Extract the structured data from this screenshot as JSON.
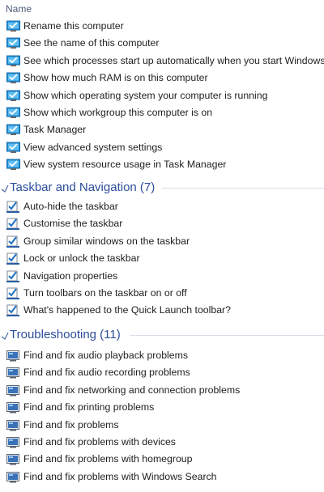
{
  "list": {
    "column_header": "Name"
  },
  "groups": [
    {
      "title": "",
      "icon": "monitor-check-icon",
      "items": [
        "Rename this computer",
        "See the name of this computer",
        "See which processes start up automatically when you start Windows",
        "Show how much RAM is on this computer",
        "Show which operating system your computer is running",
        "Show which workgroup this computer is on",
        "Task Manager",
        "View advanced system settings",
        "View system resource usage in Task Manager"
      ]
    },
    {
      "title": "Taskbar and Navigation (7)",
      "icon": "taskbar-check-icon",
      "items": [
        "Auto-hide the taskbar",
        "Customise the taskbar",
        "Group similar windows on the taskbar",
        "Lock or unlock the taskbar",
        "Navigation properties",
        "Turn toolbars on the taskbar on or off",
        "What's happened to the Quick Launch toolbar?"
      ]
    },
    {
      "title": "Troubleshooting (11)",
      "icon": "troubleshoot-icon",
      "items": [
        "Find and fix audio playback problems",
        "Find and fix audio recording problems",
        "Find and fix networking and connection problems",
        "Find and fix printing problems",
        "Find and fix problems",
        "Find and fix problems with devices",
        "Find and fix problems with homegroup",
        "Find and fix problems with Windows Search"
      ]
    }
  ],
  "colors": {
    "group_title": "#2b4e9b",
    "text": "#1e1e1e",
    "icon_blue": "#1f8fd6"
  }
}
